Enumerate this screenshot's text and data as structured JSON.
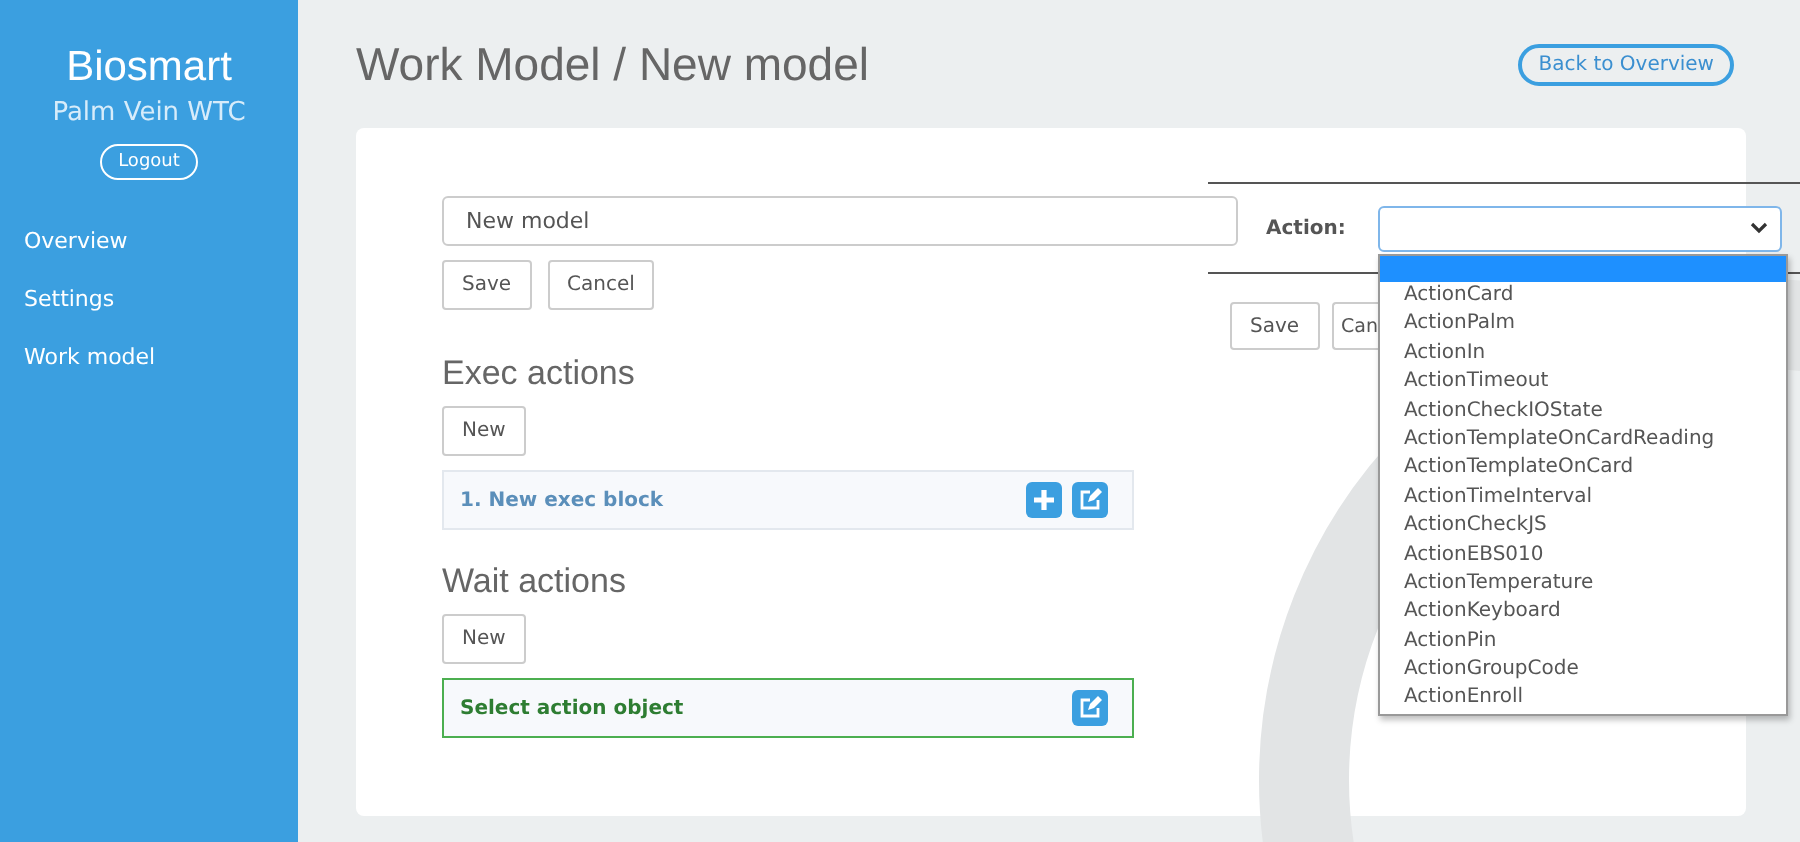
{
  "sidebar": {
    "brand": "Biosmart",
    "subtitle": "Palm Vein WTC",
    "logout": "Logout",
    "items": [
      {
        "label": "Overview",
        "selected": false
      },
      {
        "label": "Settings",
        "selected": false
      },
      {
        "label": "Work model",
        "selected": false
      }
    ]
  },
  "header": {
    "title": "Work Model / New model",
    "back_button": "Back to Overview"
  },
  "form": {
    "name_value": "New model",
    "buttons": [
      "Save",
      "Cancel"
    ]
  },
  "exec_section": {
    "heading": "Exec actions",
    "new_button": "New",
    "blocks": [
      {
        "label": "1. New exec block",
        "kind": "exec"
      }
    ]
  },
  "wait_section": {
    "heading": "Wait actions",
    "new_button": "New",
    "blocks": [
      {
        "label": "Select action object",
        "kind": "select"
      }
    ]
  },
  "action_panel": {
    "label": "Action:",
    "buttons": [
      "Save",
      "Can"
    ],
    "dropdown": {
      "blank_option_selected": true,
      "options": [
        {
          "label": "ActionCard",
          "selected": false
        },
        {
          "label": "ActionPalm",
          "selected": false
        },
        {
          "label": "ActionIn",
          "selected": false
        },
        {
          "label": "ActionTimeout",
          "selected": false
        },
        {
          "label": "ActionCheckIOState",
          "selected": false
        },
        {
          "label": "ActionTemplateOnCardReading",
          "selected": false
        },
        {
          "label": "ActionTemplateOnCard",
          "selected": false
        },
        {
          "label": "ActionTimeInterval",
          "selected": false
        },
        {
          "label": "ActionCheckJS",
          "selected": false
        },
        {
          "label": "ActionEBS010",
          "selected": false
        },
        {
          "label": "ActionTemperature",
          "selected": false
        },
        {
          "label": "ActionKeyboard",
          "selected": false
        },
        {
          "label": "ActionPin",
          "selected": false
        },
        {
          "label": "ActionGroupCode",
          "selected": false
        },
        {
          "label": "ActionEnroll",
          "selected": false
        }
      ]
    }
  }
}
